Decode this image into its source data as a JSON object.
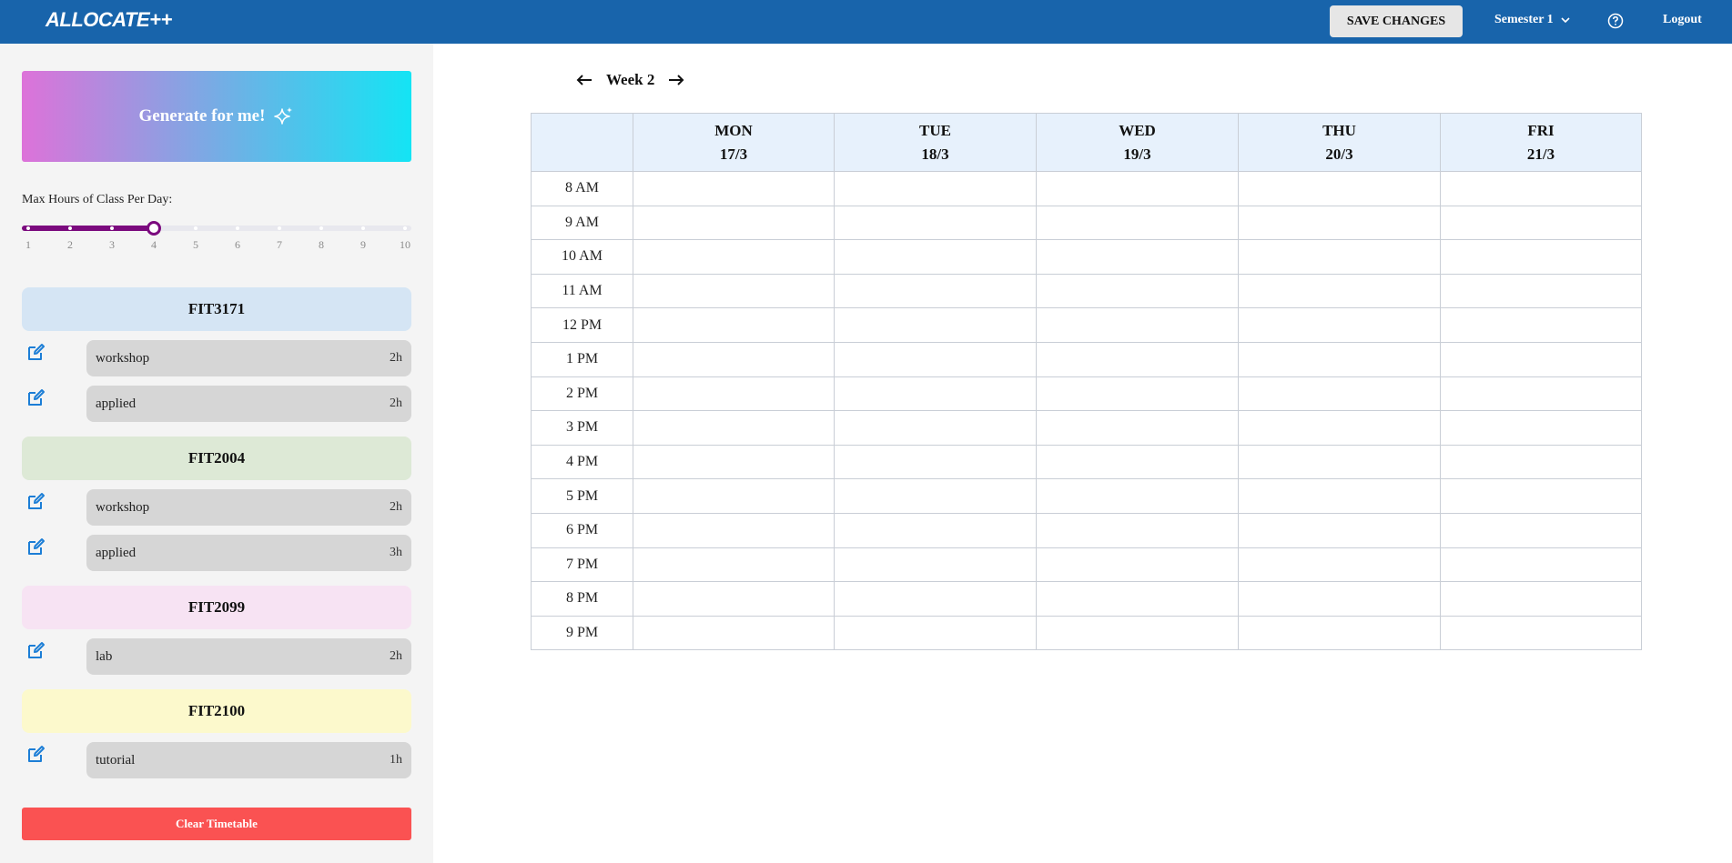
{
  "app": {
    "logo": "ALLOCATE++",
    "save_label": "SAVE CHANGES",
    "semester_label": "Semester 1",
    "logout_label": "Logout"
  },
  "sidebar": {
    "generate_label": "Generate for me!",
    "max_hours_label": "Max Hours of Class Per Day:",
    "slider": {
      "min": 1,
      "max": 10,
      "value": 4,
      "marks": [
        "1",
        "2",
        "3",
        "4",
        "5",
        "6",
        "7",
        "8",
        "9",
        "10"
      ]
    },
    "units": [
      {
        "code": "FIT3171",
        "color": "#d5e5f4",
        "activities": [
          {
            "name": "workshop",
            "hours": "2h"
          },
          {
            "name": "applied",
            "hours": "2h"
          }
        ]
      },
      {
        "code": "FIT2004",
        "color": "#dde9d6",
        "activities": [
          {
            "name": "workshop",
            "hours": "2h"
          },
          {
            "name": "applied",
            "hours": "3h"
          }
        ]
      },
      {
        "code": "FIT2099",
        "color": "#f7e3f3",
        "activities": [
          {
            "name": "lab",
            "hours": "2h"
          }
        ]
      },
      {
        "code": "FIT2100",
        "color": "#fcf9cc",
        "activities": [
          {
            "name": "tutorial",
            "hours": "1h"
          }
        ]
      }
    ],
    "clear_label": "Clear Timetable"
  },
  "timetable": {
    "week_label": "Week 2",
    "days": [
      {
        "name": "MON",
        "date": "17/3"
      },
      {
        "name": "TUE",
        "date": "18/3"
      },
      {
        "name": "WED",
        "date": "19/3"
      },
      {
        "name": "THU",
        "date": "20/3"
      },
      {
        "name": "FRI",
        "date": "21/3"
      }
    ],
    "times": [
      "8 AM",
      "9 AM",
      "10 AM",
      "11 AM",
      "12 PM",
      "1 PM",
      "2 PM",
      "3 PM",
      "4 PM",
      "5 PM",
      "6 PM",
      "7 PM",
      "8 PM",
      "9 PM"
    ]
  },
  "colors": {
    "topbar": "#1864ab",
    "accent": "#7b0a7e",
    "danger": "#fa5252",
    "header_bg": "#e7f1fc",
    "edit_icon": "#1c7ed6"
  }
}
